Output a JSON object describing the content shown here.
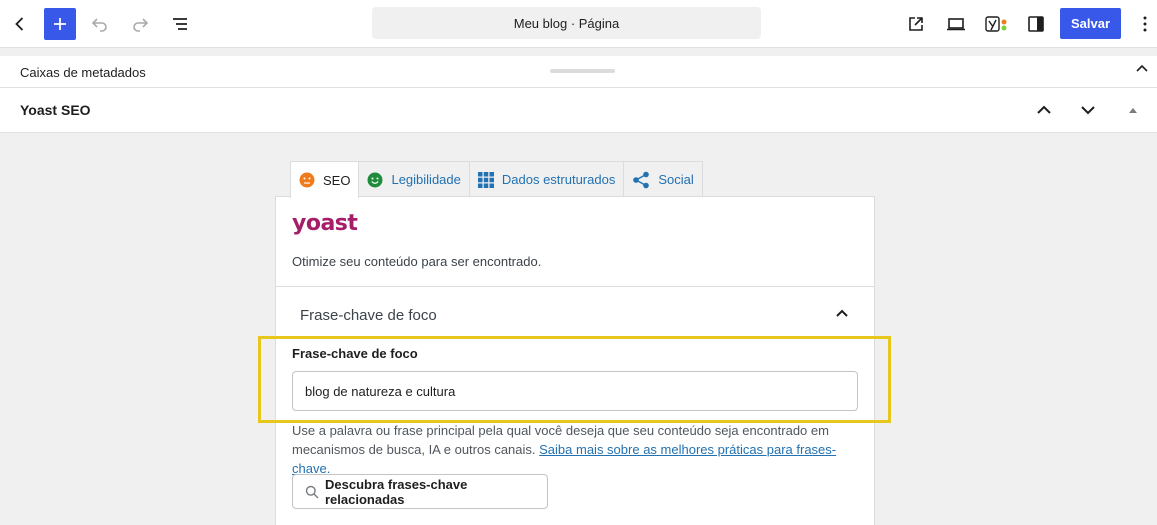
{
  "toolbar": {
    "document_title": "Meu blog · Página",
    "save_label": "Salvar"
  },
  "metabox": {
    "label": "Caixas de metadados"
  },
  "yoast_panel": {
    "label": "Yoast SEO"
  },
  "tabs": [
    {
      "label": "SEO",
      "icon": "orange-face-icon"
    },
    {
      "label": "Legibilidade",
      "icon": "green-smile-icon"
    },
    {
      "label": "Dados estruturados",
      "icon": "grid-icon"
    },
    {
      "label": "Social",
      "icon": "share-icon"
    }
  ],
  "yoast": {
    "logo": "yoast",
    "tagline": "Otimize seu conteúdo para ser encontrado.",
    "section_title": "Frase-chave de foco",
    "field_label": "Frase-chave de foco",
    "field_value": "blog de natureza e cultura",
    "help_text": "Use a palavra ou frase principal pela qual você deseja que seu conteúdo seja encontrado em mecanismos de busca, IA e outros canais. ",
    "help_link": "Saiba mais sobre as melhores práticas para frases-chave.",
    "related_button": "Descubra frases-chave relacionadas"
  },
  "colors": {
    "accent": "#3858e9",
    "yoast_brand": "#a61e69",
    "highlight": "#e8c71d",
    "seo_face": "#ee7c1b",
    "readability_face": "#1e8c3a"
  }
}
